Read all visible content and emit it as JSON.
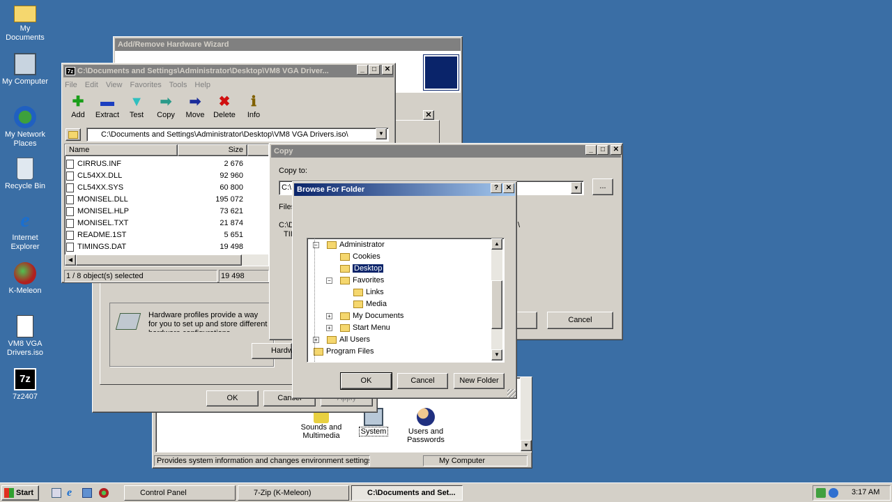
{
  "desktop_icons": [
    {
      "label": "My Documents",
      "icon": "my-documents-icon"
    },
    {
      "label": "My Computer",
      "icon": "my-computer-icon"
    },
    {
      "label": "My Network Places",
      "icon": "network-places-icon"
    },
    {
      "label": "Recycle Bin",
      "icon": "recycle-bin-icon"
    },
    {
      "label": "Internet Explorer",
      "icon": "internet-explorer-icon"
    },
    {
      "label": "K-Meleon",
      "icon": "k-meleon-icon"
    },
    {
      "label": "VM8 VGA Drivers.iso",
      "icon": "iso-file-icon"
    },
    {
      "label": "7z2407",
      "icon": "7zip-installer-icon"
    }
  ],
  "wizard": {
    "title": "Add/Remove Hardware Wizard"
  },
  "sysprops": {
    "profiles_text": "Hardware profiles provide a way for you to set up and store different hardware configurations.",
    "hardware_btn": "Hardw",
    "ok": "OK",
    "cancel": "Cancel",
    "apply": "Apply"
  },
  "control_panel": {
    "items": [
      {
        "label": "Sounds and Multimedia"
      },
      {
        "label": "System"
      },
      {
        "label": "Users and Passwords"
      }
    ],
    "status_text": "Provides system information and changes environment settings",
    "status_location": "My Computer"
  },
  "sevenzip": {
    "title": "C:\\Documents and Settings\\Administrator\\Desktop\\VM8 VGA Driver...",
    "menu": [
      "File",
      "Edit",
      "View",
      "Favorites",
      "Tools",
      "Help"
    ],
    "toolbar": [
      {
        "label": "Add",
        "glyph": "✚",
        "color": "#1a9e1a"
      },
      {
        "label": "Extract",
        "glyph": "▬",
        "color": "#1c3fc0"
      },
      {
        "label": "Test",
        "glyph": "▼",
        "color": "#2fbfbf"
      },
      {
        "label": "Copy",
        "glyph": "➡",
        "color": "#2a9a8a"
      },
      {
        "label": "Move",
        "glyph": "➡",
        "color": "#1a2c9a"
      },
      {
        "label": "Delete",
        "glyph": "✖",
        "color": "#d01010"
      },
      {
        "label": "Info",
        "glyph": "ℹ",
        "color": "#806000"
      }
    ],
    "path": "C:\\Documents and Settings\\Administrator\\Desktop\\VM8 VGA Drivers.iso\\",
    "col_name": "Name",
    "col_size": "Size",
    "files": [
      {
        "name": "CIRRUS.INF",
        "size": "2 676"
      },
      {
        "name": "CL54XX.DLL",
        "size": "92 960"
      },
      {
        "name": "CL54XX.SYS",
        "size": "60 800"
      },
      {
        "name": "MONISEL.DLL",
        "size": "195 072"
      },
      {
        "name": "MONISEL.HLP",
        "size": "73 621"
      },
      {
        "name": "MONISEL.TXT",
        "size": "21 874"
      },
      {
        "name": "README.1ST",
        "size": "5 651"
      },
      {
        "name": "TIMINGS.DAT",
        "size": "19 498"
      }
    ],
    "status_sel": "1 / 8 object(s) selected",
    "status_size": "19 498"
  },
  "copy_dialog": {
    "title": "Copy",
    "copy_to_label": "Copy to:",
    "path_value": "C:\\",
    "files_label": "Files:",
    "files_path": "C:\\D",
    "files_suffix": "\\",
    "files_item": "TII",
    "browse_btn": "...",
    "cancel": "Cancel"
  },
  "browse": {
    "title": "Browse For Folder",
    "tree": [
      {
        "label": "Administrator",
        "exp": "−"
      },
      {
        "label": "Cookies",
        "exp": ""
      },
      {
        "label": "Desktop",
        "exp": "",
        "selected": true
      },
      {
        "label": "Favorites",
        "exp": "−"
      },
      {
        "label": "Links",
        "exp": ""
      },
      {
        "label": "Media",
        "exp": ""
      },
      {
        "label": "My Documents",
        "exp": "+"
      },
      {
        "label": "Start Menu",
        "exp": "+"
      },
      {
        "label": "All Users",
        "exp": "+"
      },
      {
        "label": "Program Files",
        "exp": "+"
      }
    ],
    "ok": "OK",
    "cancel": "Cancel",
    "new_folder": "New Folder"
  },
  "taskbar": {
    "start": "Start",
    "tasks": [
      {
        "label": "Control Panel"
      },
      {
        "label": "7-Zip (K-Meleon)"
      },
      {
        "label": "C:\\Documents and Set..."
      }
    ],
    "clock": "3:17 AM"
  }
}
